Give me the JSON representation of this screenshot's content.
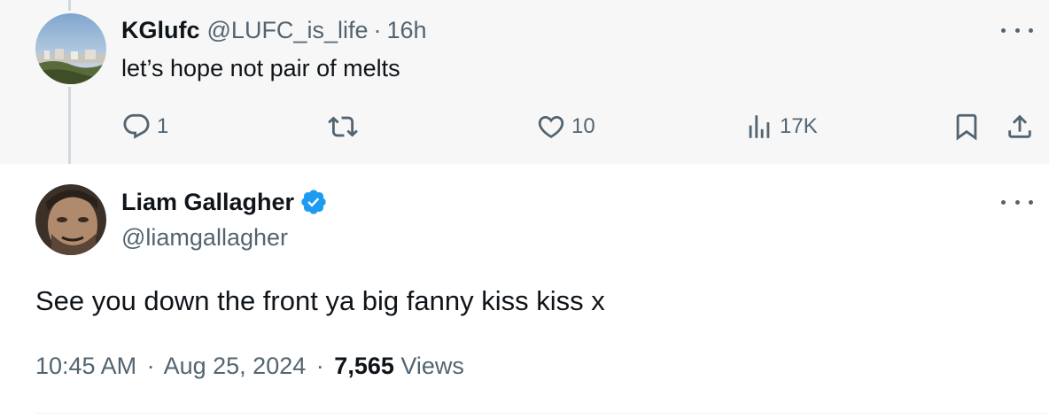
{
  "reply": {
    "display_name": "KGlufc",
    "handle": "@LUFC_is_life",
    "separator": "·",
    "time": "16h",
    "text": "let’s hope not pair of melts",
    "actions": {
      "replies": "1",
      "likes": "10",
      "views": "17K"
    }
  },
  "main_tweet": {
    "display_name": "Liam Gallagher",
    "handle": "@liamgallagher",
    "verified": true,
    "text": "See you down the front ya big fanny kiss kiss x",
    "time": "10:45 AM",
    "separator": "·",
    "date": "Aug 25, 2024",
    "views_count": "7,565",
    "views_label": "Views"
  },
  "colors": {
    "reply_background": "#f7f7f7",
    "text_primary": "#0f1419",
    "text_secondary": "#536471",
    "verified_blue": "#1d9bf0"
  }
}
